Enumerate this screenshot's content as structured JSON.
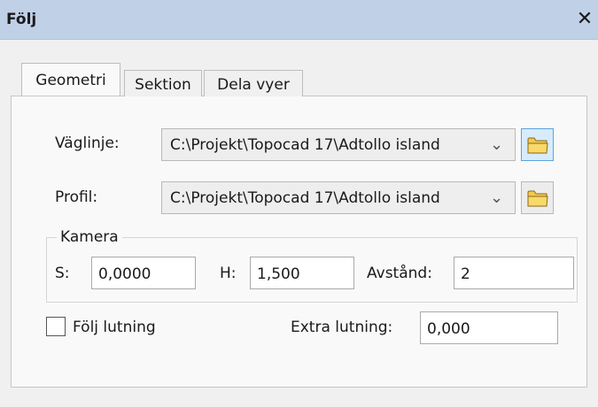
{
  "window": {
    "title": "Följ",
    "close_glyph": "✕"
  },
  "tabs": [
    "Geometri",
    "Sektion",
    "Dela vyer"
  ],
  "active_tab": "Geometri",
  "form": {
    "alignment": {
      "label": "Väglinje:",
      "value": "C:\\Projekt\\Topocad 17\\Adtollo island",
      "arrow": "⌄",
      "browse_icon": "folder-icon"
    },
    "profile": {
      "label": "Profil:",
      "value": "C:\\Projekt\\Topocad 17\\Adtollo island",
      "arrow": "⌄",
      "browse_icon": "folder-icon"
    },
    "camera": {
      "legend": "Kamera",
      "s_label": "S:",
      "s_value": "0,0000",
      "h_label": "H:",
      "h_value": "1,500",
      "distance_label": "Avstånd:",
      "distance_value": "2"
    },
    "follow_slope": {
      "label": "Följ lutning",
      "checked": false
    },
    "extra_slope": {
      "label": "Extra lutning:",
      "value": "0,000"
    }
  },
  "colors": {
    "titlebar": "#c0d0e6",
    "folder_yellow": "#f3c94d",
    "hot_border": "#5ba4df"
  }
}
